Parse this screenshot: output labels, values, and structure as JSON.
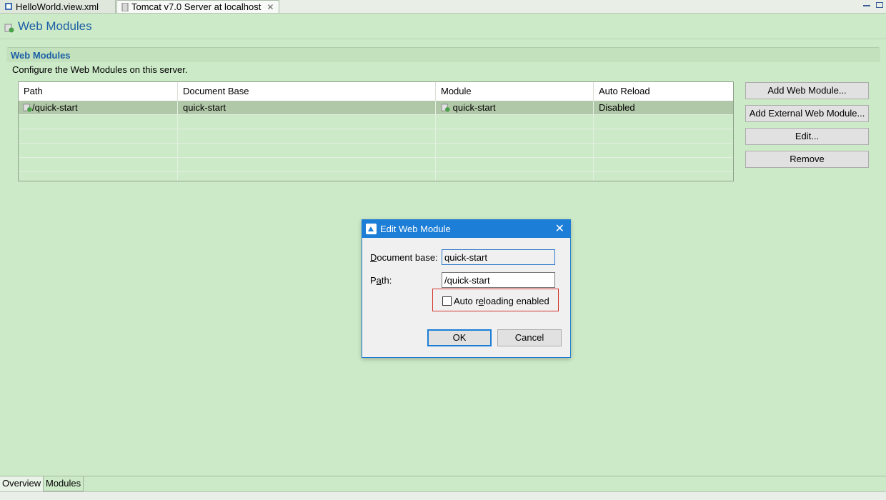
{
  "tabs": [
    {
      "label": "HelloWorld.view.xml"
    },
    {
      "label": "Tomcat v7.0 Server at localhost"
    }
  ],
  "header": {
    "title": "Web Modules"
  },
  "section": {
    "title": "Web Modules",
    "description": "Configure the Web Modules on this server."
  },
  "table": {
    "columns": [
      "Path",
      "Document Base",
      "Module",
      "Auto Reload"
    ],
    "rows": [
      {
        "path": "/quick-start",
        "document_base": "quick-start",
        "module": "quick-start",
        "auto_reload": "Disabled"
      }
    ]
  },
  "buttons": {
    "add_web_module": "Add Web Module...",
    "add_external_web_module": "Add External Web Module...",
    "edit": "Edit...",
    "remove": "Remove"
  },
  "bottom_tabs": {
    "overview": "Overview",
    "modules": "Modules"
  },
  "dialog": {
    "title": "Edit Web Module",
    "document_base_label": "Document base:",
    "document_base_value": "quick-start",
    "path_label": "Path:",
    "path_value": "/quick-start",
    "auto_reload_label": "Auto reloading enabled",
    "auto_reload_checked": false,
    "ok_label": "OK",
    "cancel_label": "Cancel"
  },
  "colors": {
    "accent": "#1c7ed6",
    "background": "#cdeac8",
    "title_blue": "#1c5fa6",
    "highlight_red": "#d2362c"
  }
}
